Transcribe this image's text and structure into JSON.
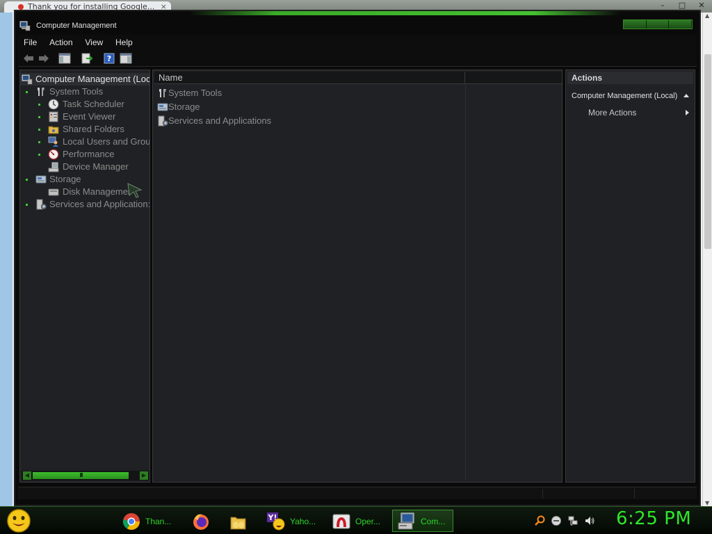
{
  "background_browser": {
    "tab_title": "Thank you for installing Google...",
    "window_controls": [
      "–",
      "□",
      "✕"
    ]
  },
  "window": {
    "title": "Computer Management",
    "menu": [
      "File",
      "Action",
      "View",
      "Help"
    ],
    "toolbar_icons": [
      "back-arrow-icon",
      "forward-arrow-icon",
      "show-hide-console-tree-icon",
      "export-list-icon",
      "help-icon",
      "show-hide-action-pane-icon"
    ]
  },
  "tree": {
    "root": "Computer Management (Loc",
    "items": [
      {
        "label": "System Tools",
        "icon": "tools-icon",
        "level": 1
      },
      {
        "label": "Task Scheduler",
        "icon": "clock-icon",
        "level": 2
      },
      {
        "label": "Event Viewer",
        "icon": "event-viewer-icon",
        "level": 2
      },
      {
        "label": "Shared Folders",
        "icon": "shared-folder-icon",
        "level": 2
      },
      {
        "label": "Local Users and Grou",
        "icon": "users-icon",
        "level": 2
      },
      {
        "label": "Performance",
        "icon": "performance-icon",
        "level": 2
      },
      {
        "label": "Device Manager",
        "icon": "device-manager-icon",
        "level": 2
      },
      {
        "label": "Storage",
        "icon": "storage-icon",
        "level": 1
      },
      {
        "label": "Disk Managemer",
        "icon": "disk-icon",
        "level": 2
      },
      {
        "label": "Services and Application:",
        "icon": "services-icon",
        "level": 1
      }
    ]
  },
  "center": {
    "column_header": "Name",
    "rows": [
      {
        "label": "System Tools",
        "icon": "tools-icon"
      },
      {
        "label": "Storage",
        "icon": "storage-icon"
      },
      {
        "label": "Services and Applications",
        "icon": "services-icon"
      }
    ]
  },
  "actions": {
    "header": "Actions",
    "section": "Computer Management (Local)",
    "more": "More Actions"
  },
  "taskbar": {
    "buttons": [
      {
        "label": "Than...",
        "icon": "chrome-icon"
      },
      {
        "label": "",
        "icon": "firefox-icon"
      },
      {
        "label": "",
        "icon": "folders-icon"
      },
      {
        "label": "Yaho...",
        "icon": "yahoo-messenger-icon"
      },
      {
        "label": "Oper...",
        "icon": "opera-icon"
      },
      {
        "label": "Com...",
        "icon": "computer-management-icon"
      }
    ],
    "clock": "6:25 PM"
  },
  "colors": {
    "accent": "#2ee82a",
    "window_bg": "#0a0a0a",
    "pane_bg": "#1f2124"
  }
}
